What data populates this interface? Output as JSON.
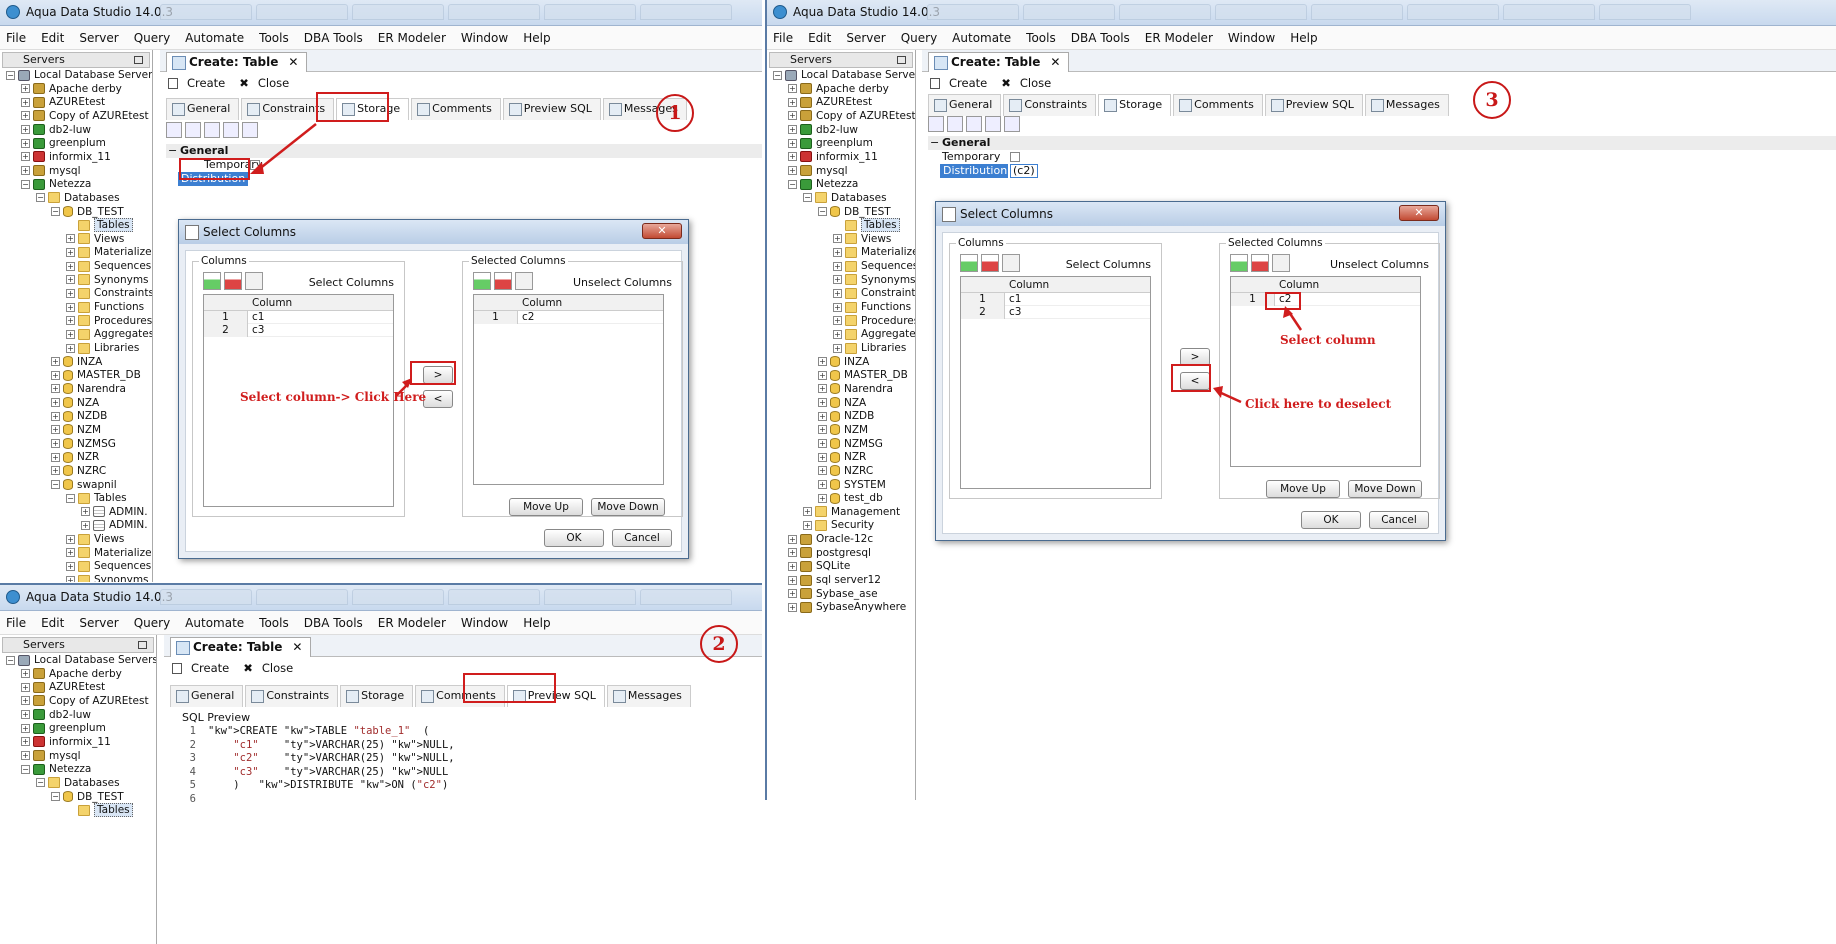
{
  "app_title": "Aqua Data Studio 14.0.3",
  "menu": [
    "File",
    "Edit",
    "Server",
    "Query",
    "Automate",
    "Tools",
    "DBA Tools",
    "ER Modeler",
    "Window",
    "Help"
  ],
  "servers_label": "Servers",
  "doc_tab": "Create: Table",
  "toolbar": {
    "create": "Create",
    "close": "Close"
  },
  "subtabs": [
    "General",
    "Constraints",
    "Storage",
    "Comments",
    "Preview SQL",
    "Messages"
  ],
  "props": {
    "group": "General",
    "temporary": "Temporary",
    "distribution": "Distribution",
    "distribution_value": "(c2)"
  },
  "tree1": [
    {
      "label": "Local Database Servers",
      "lvl": 0,
      "ic": "srv",
      "exp": "−"
    },
    {
      "label": "Apache derby",
      "lvl": 1,
      "ic": "db",
      "exp": "+"
    },
    {
      "label": "AZUREtest",
      "lvl": 1,
      "ic": "db",
      "exp": "+"
    },
    {
      "label": "Copy of AZUREtest",
      "lvl": 1,
      "ic": "db",
      "exp": "+"
    },
    {
      "label": "db2-luw",
      "lvl": 1,
      "ic": "dbg",
      "exp": "+"
    },
    {
      "label": "greenplum",
      "lvl": 1,
      "ic": "dbg",
      "exp": "+"
    },
    {
      "label": "informix_11",
      "lvl": 1,
      "ic": "dbr",
      "exp": "+"
    },
    {
      "label": "mysql",
      "lvl": 1,
      "ic": "db",
      "exp": "+"
    },
    {
      "label": "Netezza",
      "lvl": 1,
      "ic": "dbg",
      "exp": "−"
    },
    {
      "label": "Databases",
      "lvl": 2,
      "ic": "fold",
      "exp": "−"
    },
    {
      "label": "DB_TEST",
      "lvl": 3,
      "ic": "cyl",
      "exp": "−"
    },
    {
      "label": "Tables",
      "lvl": 4,
      "ic": "fold",
      "exp": "",
      "sel": true
    },
    {
      "label": "Views",
      "lvl": 4,
      "ic": "fold",
      "exp": "+"
    },
    {
      "label": "Materialized",
      "lvl": 4,
      "ic": "fold",
      "exp": "+"
    },
    {
      "label": "Sequences",
      "lvl": 4,
      "ic": "fold",
      "exp": "+"
    },
    {
      "label": "Synonyms",
      "lvl": 4,
      "ic": "fold",
      "exp": "+"
    },
    {
      "label": "Constraints",
      "lvl": 4,
      "ic": "fold",
      "exp": "+"
    },
    {
      "label": "Functions",
      "lvl": 4,
      "ic": "fold",
      "exp": "+"
    },
    {
      "label": "Procedures",
      "lvl": 4,
      "ic": "fold",
      "exp": "+"
    },
    {
      "label": "Aggregates",
      "lvl": 4,
      "ic": "fold",
      "exp": "+"
    },
    {
      "label": "Libraries",
      "lvl": 4,
      "ic": "fold",
      "exp": "+"
    },
    {
      "label": "INZA",
      "lvl": 3,
      "ic": "cyl",
      "exp": "+"
    },
    {
      "label": "MASTER_DB",
      "lvl": 3,
      "ic": "cyl",
      "exp": "+"
    },
    {
      "label": "Narendra",
      "lvl": 3,
      "ic": "cyl",
      "exp": "+"
    },
    {
      "label": "NZA",
      "lvl": 3,
      "ic": "cyl",
      "exp": "+"
    },
    {
      "label": "NZDB",
      "lvl": 3,
      "ic": "cyl",
      "exp": "+"
    },
    {
      "label": "NZM",
      "lvl": 3,
      "ic": "cyl",
      "exp": "+"
    },
    {
      "label": "NZMSG",
      "lvl": 3,
      "ic": "cyl",
      "exp": "+"
    },
    {
      "label": "NZR",
      "lvl": 3,
      "ic": "cyl",
      "exp": "+"
    },
    {
      "label": "NZRC",
      "lvl": 3,
      "ic": "cyl",
      "exp": "+"
    },
    {
      "label": "swapnil",
      "lvl": 3,
      "ic": "cyl",
      "exp": "−"
    },
    {
      "label": "Tables",
      "lvl": 4,
      "ic": "fold",
      "exp": "−"
    },
    {
      "label": "ADMIN.",
      "lvl": 5,
      "ic": "tbl",
      "exp": "+"
    },
    {
      "label": "ADMIN.",
      "lvl": 5,
      "ic": "tbl",
      "exp": "+"
    },
    {
      "label": "Views",
      "lvl": 4,
      "ic": "fold",
      "exp": "+"
    },
    {
      "label": "Materialized",
      "lvl": 4,
      "ic": "fold",
      "exp": "+"
    },
    {
      "label": "Sequences",
      "lvl": 4,
      "ic": "fold",
      "exp": "+"
    },
    {
      "label": "Synonyms",
      "lvl": 4,
      "ic": "fold",
      "exp": "+"
    }
  ],
  "tree3_extra": [
    {
      "label": "SYSTEM",
      "lvl": 3,
      "ic": "cyl",
      "exp": "+"
    },
    {
      "label": "test_db",
      "lvl": 3,
      "ic": "cyl",
      "exp": "+"
    },
    {
      "label": "Management",
      "lvl": 2,
      "ic": "fold",
      "exp": "+"
    },
    {
      "label": "Security",
      "lvl": 2,
      "ic": "fold",
      "exp": "+"
    },
    {
      "label": "Oracle-12c",
      "lvl": 1,
      "ic": "db",
      "exp": "+"
    },
    {
      "label": "postgresql",
      "lvl": 1,
      "ic": "db",
      "exp": "+"
    },
    {
      "label": "SQLite",
      "lvl": 1,
      "ic": "db",
      "exp": "+"
    },
    {
      "label": "sql server12",
      "lvl": 1,
      "ic": "db",
      "exp": "+"
    },
    {
      "label": "Sybase_ase",
      "lvl": 1,
      "ic": "db",
      "exp": "+"
    },
    {
      "label": "SybaseAnywhere",
      "lvl": 1,
      "ic": "db",
      "exp": "+"
    }
  ],
  "dialog": {
    "title": "Select Columns",
    "columns": "Columns",
    "select_columns": "Select Columns",
    "selected_columns": "Selected Columns",
    "unselect_columns": "Unselect Columns",
    "column_header": "Column",
    "move_up": "Move Up",
    "move_down": "Move Down",
    "ok": "OK",
    "cancel": "Cancel",
    "right": ">",
    "left": "<"
  },
  "dlg1": {
    "available": [
      {
        "n": "1",
        "v": "c1"
      },
      {
        "n": "2",
        "v": "c3"
      }
    ],
    "selected": [
      {
        "n": "1",
        "v": "c2"
      }
    ]
  },
  "dlg3": {
    "available": [
      {
        "n": "1",
        "v": "c1"
      },
      {
        "n": "2",
        "v": "c3"
      }
    ],
    "selected": [
      {
        "n": "1",
        "v": "c2"
      }
    ]
  },
  "sql": {
    "label": "SQL Preview",
    "lines": [
      {
        "n": "1",
        "t": "CREATE TABLE \"table_1\"  ("
      },
      {
        "n": "2",
        "t": "    \"c1\"    VARCHAR(25) NULL,"
      },
      {
        "n": "3",
        "t": "    \"c2\"    VARCHAR(25) NULL,"
      },
      {
        "n": "4",
        "t": "    \"c3\"    VARCHAR(25) NULL"
      },
      {
        "n": "5",
        "t": "    )   DISTRIBUTE ON (\"c2\")"
      },
      {
        "n": "6",
        "t": ""
      }
    ]
  },
  "annotations": {
    "step1": "1",
    "step2": "2",
    "step3": "3",
    "select_click": "Select column-> Click Here",
    "select_column": "Select column",
    "click_deselect": "Click here to deselect"
  },
  "colors": {
    "annotation_red": "#d01d1d",
    "selection_blue": "#3c7fd1"
  }
}
